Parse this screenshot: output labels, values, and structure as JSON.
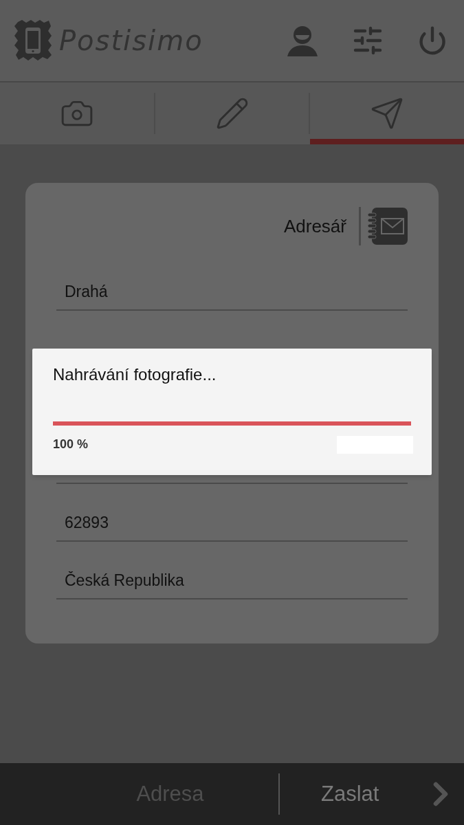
{
  "app": {
    "title": "Postisimo"
  },
  "tabs": [
    {
      "kind": "camera",
      "selected": false
    },
    {
      "kind": "pencil",
      "selected": false
    },
    {
      "kind": "send",
      "selected": true
    }
  ],
  "address_book": {
    "label": "Adresář"
  },
  "fields": [
    {
      "value": "Drahá"
    },
    {
      "value": "62893"
    },
    {
      "value": "Česká Republika"
    }
  ],
  "dialog": {
    "title": "Nahrávání fotografie...",
    "progress": {
      "level": 1,
      "reading": "100 %"
    }
  },
  "footer": [
    {
      "label": "Adresa",
      "disabled": true
    },
    {
      "label": "Zaslat",
      "disabled": false
    }
  ]
}
